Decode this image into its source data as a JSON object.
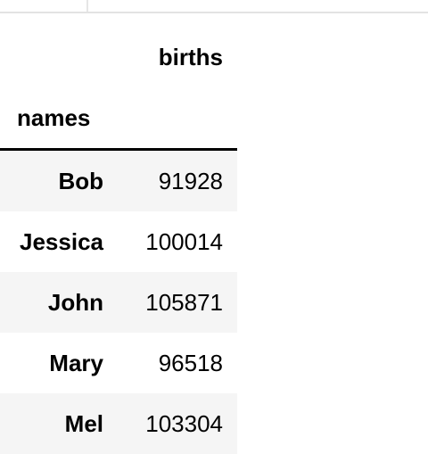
{
  "dataframe": {
    "columns": [
      "births"
    ],
    "index_name": "names",
    "rows": [
      {
        "name": "Bob",
        "births": "91928"
      },
      {
        "name": "Jessica",
        "births": "100014"
      },
      {
        "name": "John",
        "births": "105871"
      },
      {
        "name": "Mary",
        "births": "96518"
      },
      {
        "name": "Mel",
        "births": "103304"
      }
    ]
  },
  "colors": {
    "odd_row_bg": "#f5f5f5",
    "even_row_bg": "#ffffff",
    "header_rule": "#000000"
  }
}
